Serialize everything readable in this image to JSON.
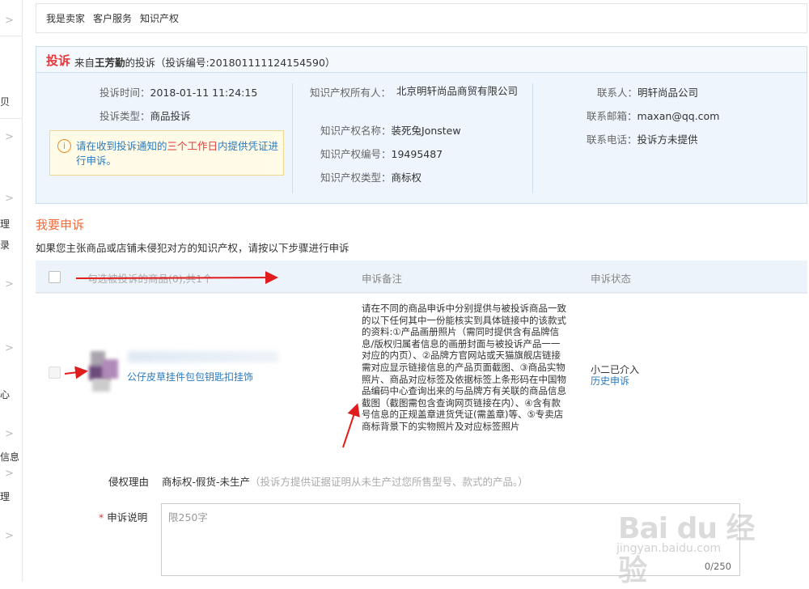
{
  "sidebar": {
    "items": [
      "贝",
      "理",
      "录",
      "心",
      "信息",
      "理"
    ]
  },
  "topbar": {
    "links": [
      "我是卖家",
      "客户服务",
      "知识产权"
    ]
  },
  "complaint": {
    "title": "投诉",
    "from_prefix": "来自",
    "complainant": "王芳勤",
    "from_suffix": "的投诉（投诉编号:201801111124154590）",
    "time_label": "投诉时间：",
    "time_value": "2018-01-11 11:24:15",
    "type_label": "投诉类型：",
    "type_value": "商品投诉",
    "notice_pre": "请在收到投诉通知的",
    "notice_red": "三个工作日",
    "notice_post": "内提供凭证进行申诉。",
    "ip_owner_label": "知识产权所有人：",
    "ip_owner_value": "北京明轩尚品商贸有限公司",
    "ip_name_label": "知识产权名称：",
    "ip_name_value": "装死兔Jonstew",
    "ip_no_label": "知识产权编号：",
    "ip_no_value": "19495487",
    "ip_type_label": "知识产权类型：",
    "ip_type_value": "商标权",
    "contact_label": "联系人：",
    "contact_value": "明轩尚品公司",
    "email_label": "联系邮箱：",
    "email_value": "maxan@qq.com",
    "phone_label": "联系电话：",
    "phone_value": "投诉方未提供"
  },
  "appeal": {
    "title": "我要申诉",
    "desc": "如果您主张商品或店铺未侵犯对方的知识产权，请按以下步骤进行申诉"
  },
  "table": {
    "headers": [
      "勾选被投诉的商品(0),共1个",
      "申诉备注",
      "申诉状态"
    ],
    "row": {
      "product": "公仔皮草挂件包包钥匙扣挂饰",
      "remark": "请在不同的商品申诉中分别提供与被投诉商品一致的以下任何其中一份能核实到具体链接中的该款式的资料:①产品画册照片（需同时提供含有品牌信息/版权归属者信息的画册封面与被投诉产品一一对应的内页）、②品牌方官网站或天猫旗舰店链接需对应显示链接信息的产品页面截图、③商品实物照片、商品对应标签及依据标签上条形码在中国物品编码中心查询出来的与品牌方有关联的商品信息截图（截图需包含查询网页链接在内）、④含有款号信息的正规盖章进货凭证(需盖章)等、⑤专卖店商标背景下的实物照片及对应标签照片",
      "status": "小二已介入",
      "history": "历史申诉"
    }
  },
  "form": {
    "reason_label": "侵权理由",
    "reason_value": "商标权-假货-未生产",
    "reason_hint": "（投诉方提供证据证明从未生产过您所售型号、款式的产品。）",
    "desc_label": "申诉说明",
    "desc_placeholder": "限250字",
    "desc_counter": "0/250"
  },
  "watermark": {
    "main": "Bai du 经验",
    "sub": "jingyan.baidu.com"
  },
  "colors": {
    "accent_red": "#e4393c",
    "link_blue": "#2b7bbf",
    "section_orange": "#f26b3a",
    "panel_bg": "#eef5fc"
  }
}
